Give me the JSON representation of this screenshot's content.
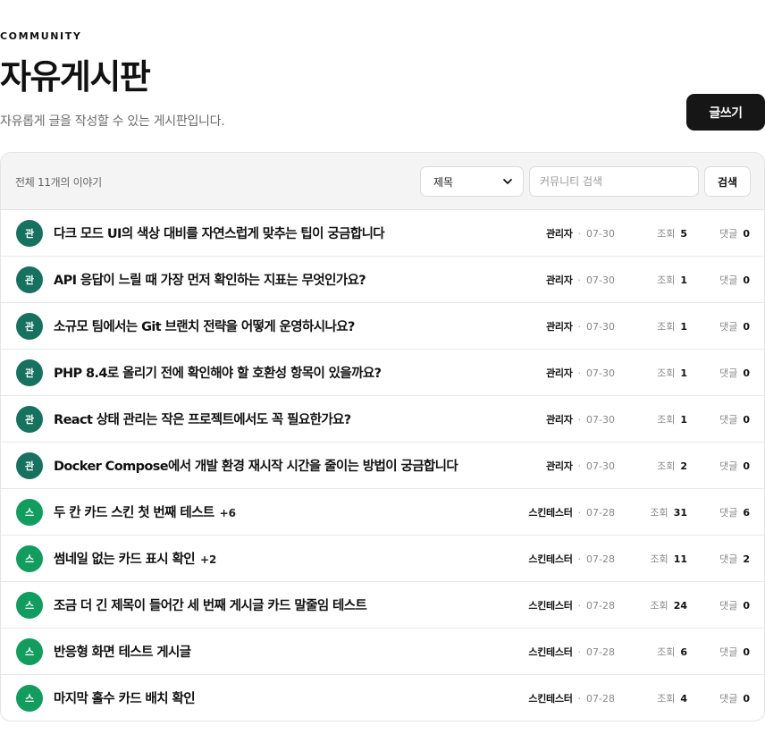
{
  "header": {
    "eyebrow": "COMMUNITY",
    "title": "자유게시판",
    "subtitle": "자유롭게 글을 작성할 수 있는 게시판입니다.",
    "write_label": "글쓰기"
  },
  "toolbar": {
    "total": "전체 11개의 이야기",
    "search_field": "제목",
    "search_placeholder": "커뮤니티 검색",
    "search_label": "검색"
  },
  "colors": {
    "admin_avatar": "#17715f",
    "tester_avatar": "#129c5e",
    "primary_button": "#161616"
  },
  "labels": {
    "views": "조회",
    "comments": "댓글",
    "separator": "·"
  },
  "posts": [
    {
      "avatar": "관",
      "kind": "admin",
      "title": "다크 모드 UI의 색상 대비를 자연스럽게 맞추는 팁이 궁금합니다",
      "comment_count": "",
      "author": "관리자",
      "date": "07-30",
      "views": "5",
      "comments": "0"
    },
    {
      "avatar": "관",
      "kind": "admin",
      "title": "API 응답이 느릴 때 가장 먼저 확인하는 지표는 무엇인가요?",
      "comment_count": "",
      "author": "관리자",
      "date": "07-30",
      "views": "1",
      "comments": "0"
    },
    {
      "avatar": "관",
      "kind": "admin",
      "title": "소규모 팀에서는 Git 브랜치 전략을 어떻게 운영하시나요?",
      "comment_count": "",
      "author": "관리자",
      "date": "07-30",
      "views": "1",
      "comments": "0"
    },
    {
      "avatar": "관",
      "kind": "admin",
      "title": "PHP 8.4로 올리기 전에 확인해야 할 호환성 항목이 있을까요?",
      "comment_count": "",
      "author": "관리자",
      "date": "07-30",
      "views": "1",
      "comments": "0"
    },
    {
      "avatar": "관",
      "kind": "admin",
      "title": "React 상태 관리는 작은 프로젝트에서도 꼭 필요한가요?",
      "comment_count": "",
      "author": "관리자",
      "date": "07-30",
      "views": "1",
      "comments": "0"
    },
    {
      "avatar": "관",
      "kind": "admin",
      "title": "Docker Compose에서 개발 환경 재시작 시간을 줄이는 방법이 궁금합니다",
      "comment_count": "",
      "author": "관리자",
      "date": "07-30",
      "views": "2",
      "comments": "0"
    },
    {
      "avatar": "스",
      "kind": "tester",
      "title": "두 칸 카드 스킨 첫 번째 테스트",
      "comment_count": "+6",
      "author": "스킨테스터",
      "date": "07-28",
      "views": "31",
      "comments": "6"
    },
    {
      "avatar": "스",
      "kind": "tester",
      "title": "썸네일 없는 카드 표시 확인",
      "comment_count": "+2",
      "author": "스킨테스터",
      "date": "07-28",
      "views": "11",
      "comments": "2"
    },
    {
      "avatar": "스",
      "kind": "tester",
      "title": "조금 더 긴 제목이 들어간 세 번째 게시글 카드 말줄임 테스트",
      "comment_count": "",
      "author": "스킨테스터",
      "date": "07-28",
      "views": "24",
      "comments": "0"
    },
    {
      "avatar": "스",
      "kind": "tester",
      "title": "반응형 화면 테스트 게시글",
      "comment_count": "",
      "author": "스킨테스터",
      "date": "07-28",
      "views": "6",
      "comments": "0"
    },
    {
      "avatar": "스",
      "kind": "tester",
      "title": "마지막 홀수 카드 배치 확인",
      "comment_count": "",
      "author": "스킨테스터",
      "date": "07-28",
      "views": "4",
      "comments": "0"
    }
  ]
}
